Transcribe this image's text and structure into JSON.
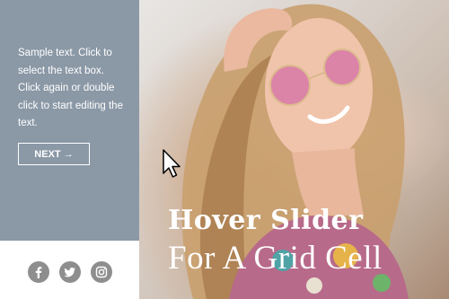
{
  "sidebar": {
    "body_text": "Sample text. Click to select the text box. Click again or double click to start editing the text.",
    "next_label": "NEXT →"
  },
  "slide": {
    "title": "Hover Slider",
    "subtitle": "For A Grid Cell"
  },
  "social": {
    "icons": [
      "facebook-icon",
      "twitter-icon",
      "instagram-icon"
    ],
    "icon_color": "#8e8e8e"
  },
  "colors": {
    "sidebar_bg": "#8b98a6",
    "text": "#ffffff"
  }
}
